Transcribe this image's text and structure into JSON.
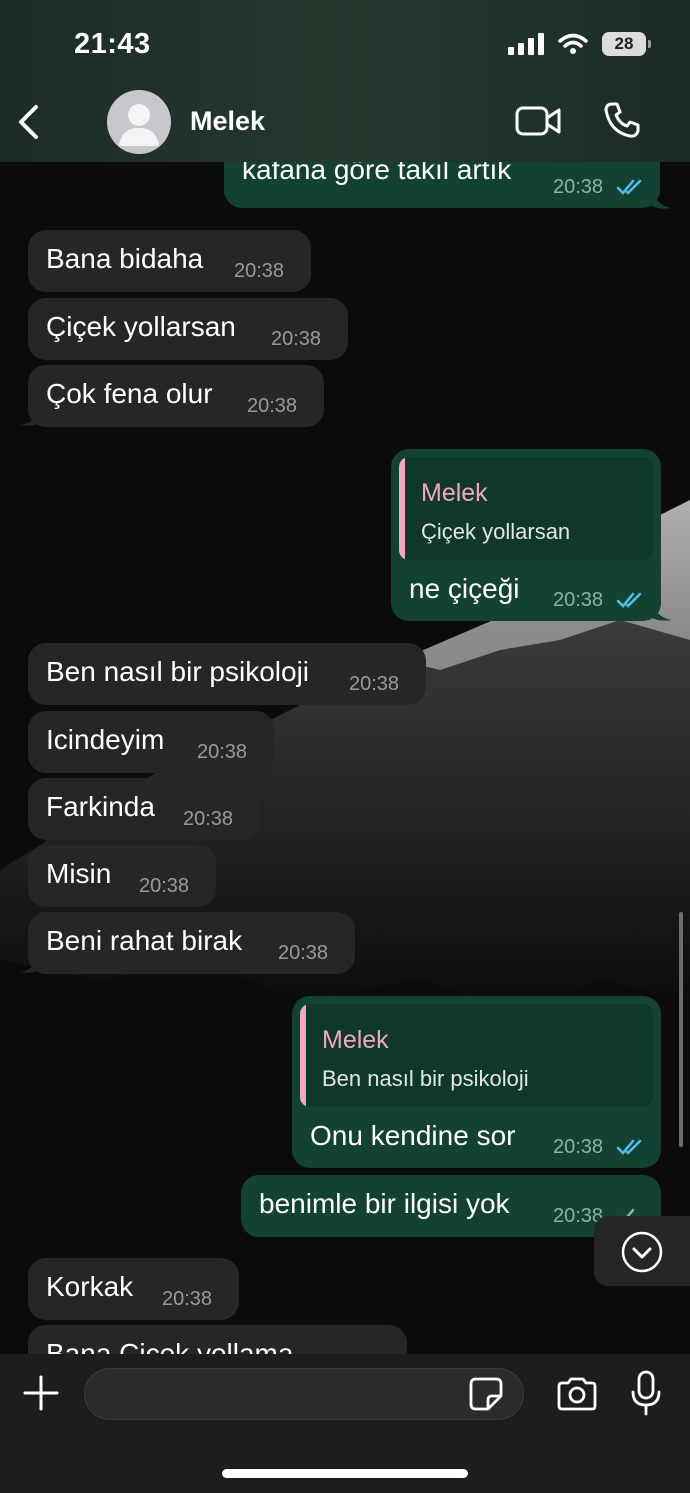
{
  "status_bar": {
    "time": "21:43",
    "battery": "28"
  },
  "header": {
    "contact_name": "Melek"
  },
  "messages": [
    {
      "dir": "out",
      "text": "kafana göre takıl artık",
      "time": "20:38"
    },
    {
      "dir": "in",
      "text": "Bana bidaha",
      "time": "20:38"
    },
    {
      "dir": "in",
      "text": "Çiçek yollarsan",
      "time": "20:38"
    },
    {
      "dir": "in",
      "text": "Çok fena olur",
      "time": "20:38"
    },
    {
      "dir": "out",
      "reply_name": "Melek",
      "reply_text": "Çiçek yollarsan",
      "text": "ne çiçeği",
      "time": "20:38"
    },
    {
      "dir": "in",
      "text": "Ben nasıl bir psikoloji",
      "time": "20:38"
    },
    {
      "dir": "in",
      "text": "Icindeyim",
      "time": "20:38"
    },
    {
      "dir": "in",
      "text": "Farkinda",
      "time": "20:38"
    },
    {
      "dir": "in",
      "text": "Misin",
      "time": "20:38"
    },
    {
      "dir": "in",
      "text": "Beni rahat birak",
      "time": "20:38"
    },
    {
      "dir": "out",
      "reply_name": "Melek",
      "reply_text": "Ben nasıl bir psikoloji",
      "text": "Onu kendine sor",
      "time": "20:38"
    },
    {
      "dir": "out",
      "text": "benimle bir ilgisi yok",
      "time": "20:38"
    },
    {
      "dir": "in",
      "text": "Korkak",
      "time": "20:38"
    },
    {
      "dir": "in",
      "text": "Bana Çiçek yollama",
      "time": ""
    }
  ],
  "composer": {
    "placeholder": ""
  },
  "icons": {
    "back": "chevron-left-icon",
    "avatar": "person-icon",
    "video": "video-camera-icon",
    "call": "phone-icon",
    "read_receipt": "double-check-icon",
    "sent_receipt": "single-check-icon",
    "scroll_down": "chevron-down-circle-icon",
    "attach": "plus-icon",
    "sticker": "sticker-icon",
    "camera": "camera-icon",
    "mic": "microphone-icon"
  },
  "colors": {
    "incoming_bubble": "#262628",
    "outgoing_bubble": "#134232",
    "read_tick": "#53bdeb",
    "quote_accent": "#f3a9c2"
  }
}
